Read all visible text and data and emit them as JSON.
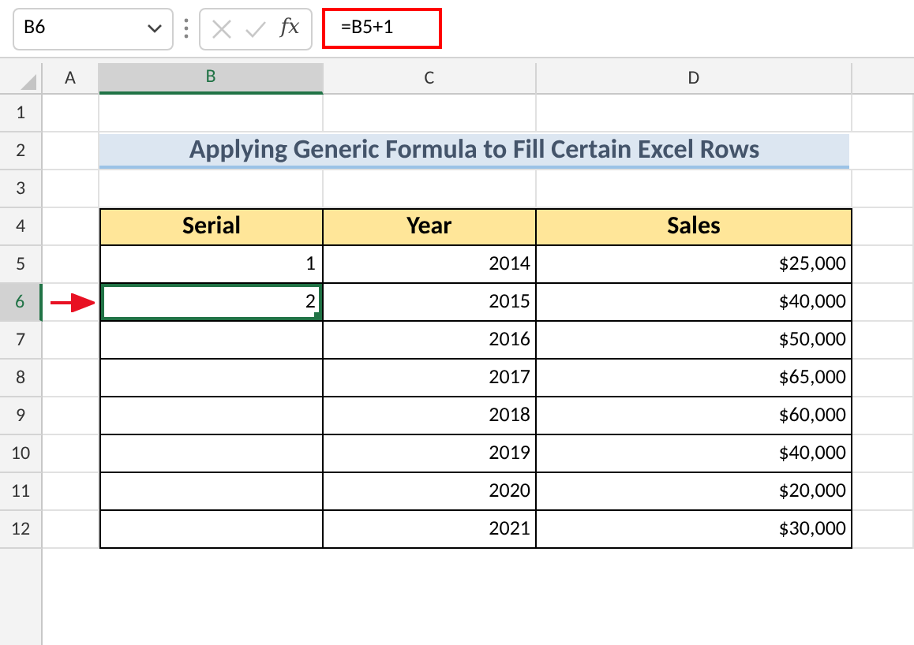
{
  "name_box": "B6",
  "formula": "=B5+1",
  "function_button": "fx",
  "column_headers": [
    {
      "label": "A",
      "selected": false
    },
    {
      "label": "B",
      "selected": true
    },
    {
      "label": "C",
      "selected": false
    },
    {
      "label": "D",
      "selected": false
    }
  ],
  "row_headers": [
    {
      "label": "1",
      "selected": false
    },
    {
      "label": "2",
      "selected": false
    },
    {
      "label": "3",
      "selected": false
    },
    {
      "label": "4",
      "selected": false
    },
    {
      "label": "5",
      "selected": false
    },
    {
      "label": "6",
      "selected": true
    },
    {
      "label": "7",
      "selected": false
    },
    {
      "label": "8",
      "selected": false
    },
    {
      "label": "9",
      "selected": false
    },
    {
      "label": "10",
      "selected": false
    },
    {
      "label": "11",
      "selected": false
    },
    {
      "label": "12",
      "selected": false
    }
  ],
  "title": "Applying Generic Formula to Fill Certain Excel Rows",
  "table": {
    "columns": [
      "Serial",
      "Year",
      "Sales"
    ],
    "rows": [
      {
        "serial": "1",
        "year": "2014",
        "sales": "$25,000",
        "selected": false
      },
      {
        "serial": "2",
        "year": "2015",
        "sales": "$40,000",
        "selected": true
      },
      {
        "year": "2016",
        "sales": "$50,000",
        "selected": false
      },
      {
        "year": "2017",
        "sales": "$65,000",
        "selected": false
      },
      {
        "year": "2018",
        "sales": "$60,000",
        "selected": false
      },
      {
        "year": "2019",
        "sales": "$40,000",
        "selected": false
      },
      {
        "year": "2020",
        "sales": "$20,000",
        "selected": false
      },
      {
        "year": "2021",
        "sales": "$30,000",
        "selected": false
      }
    ]
  }
}
